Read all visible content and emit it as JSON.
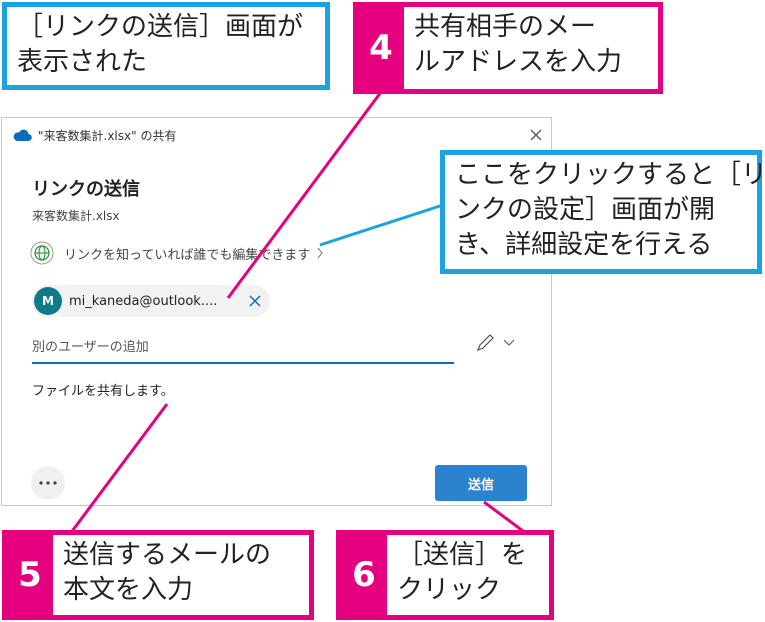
{
  "dialog": {
    "window_title": "\"来客数集計.xlsx\" の共有",
    "heading": "リンクの送信",
    "filename": "来客数集計.xlsx",
    "link_setting": "リンクを知っていれば誰でも編集できます",
    "recipient": {
      "avatar_initial": "M",
      "email": "mi_kaneda@outlook...."
    },
    "add_user_placeholder": "別のユーザーの追加",
    "message": "ファイルを共有します。",
    "send_label": "送信"
  },
  "annotations": {
    "screen_shown": [
      "［リンクの送信］画面が",
      "表示された"
    ],
    "link_settings_note": [
      "ここをクリックすると［リ",
      "ンクの設定］画面が開",
      "き、詳細設定を行える"
    ],
    "steps": [
      {
        "number": "4",
        "lines": [
          "共有相手のメー",
          "ルアドレスを入力"
        ]
      },
      {
        "number": "5",
        "lines": [
          "送信するメールの",
          "本文を入力"
        ]
      },
      {
        "number": "6",
        "lines": [
          "［送信］を",
          "クリック"
        ]
      }
    ]
  },
  "colors": {
    "accent_magenta": "#e4007f",
    "accent_cyan": "#1aa3df",
    "send_button": "#2b83cf",
    "avatar": "#0e7c86"
  }
}
